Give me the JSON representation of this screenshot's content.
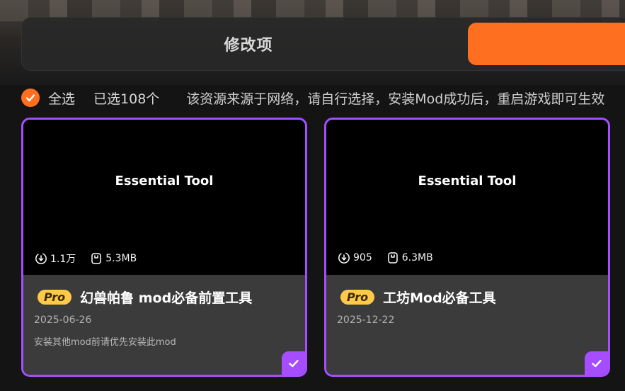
{
  "tabs": {
    "modify_label": "修改项"
  },
  "selection": {
    "select_all_label": "全选",
    "selected_count": "已选108个",
    "notice": "该资源来源于网络，请自行选择，安装Mod成功后，重启游戏即可生效"
  },
  "cards": [
    {
      "thumb_title": "Essential Tool",
      "downloads": "1.1万",
      "size": "5.3MB",
      "badge": "Pro",
      "name": "幻兽帕鲁 mod必备前置工具",
      "date": "2025-06-26",
      "description": "安装其他mod前请优先安装此mod",
      "selected": true
    },
    {
      "thumb_title": "Essential Tool",
      "downloads": "905",
      "size": "6.3MB",
      "badge": "Pro",
      "name": "工坊Mod必备工具",
      "date": "2025-12-22",
      "description": "",
      "selected": true
    }
  ],
  "colors": {
    "accent_orange": "#ff6f1f",
    "accent_purple": "#a64dff",
    "pro_badge": "#ffc94a"
  },
  "icons": {
    "check": "check-icon",
    "download": "download-icon",
    "size": "file-size-icon"
  }
}
